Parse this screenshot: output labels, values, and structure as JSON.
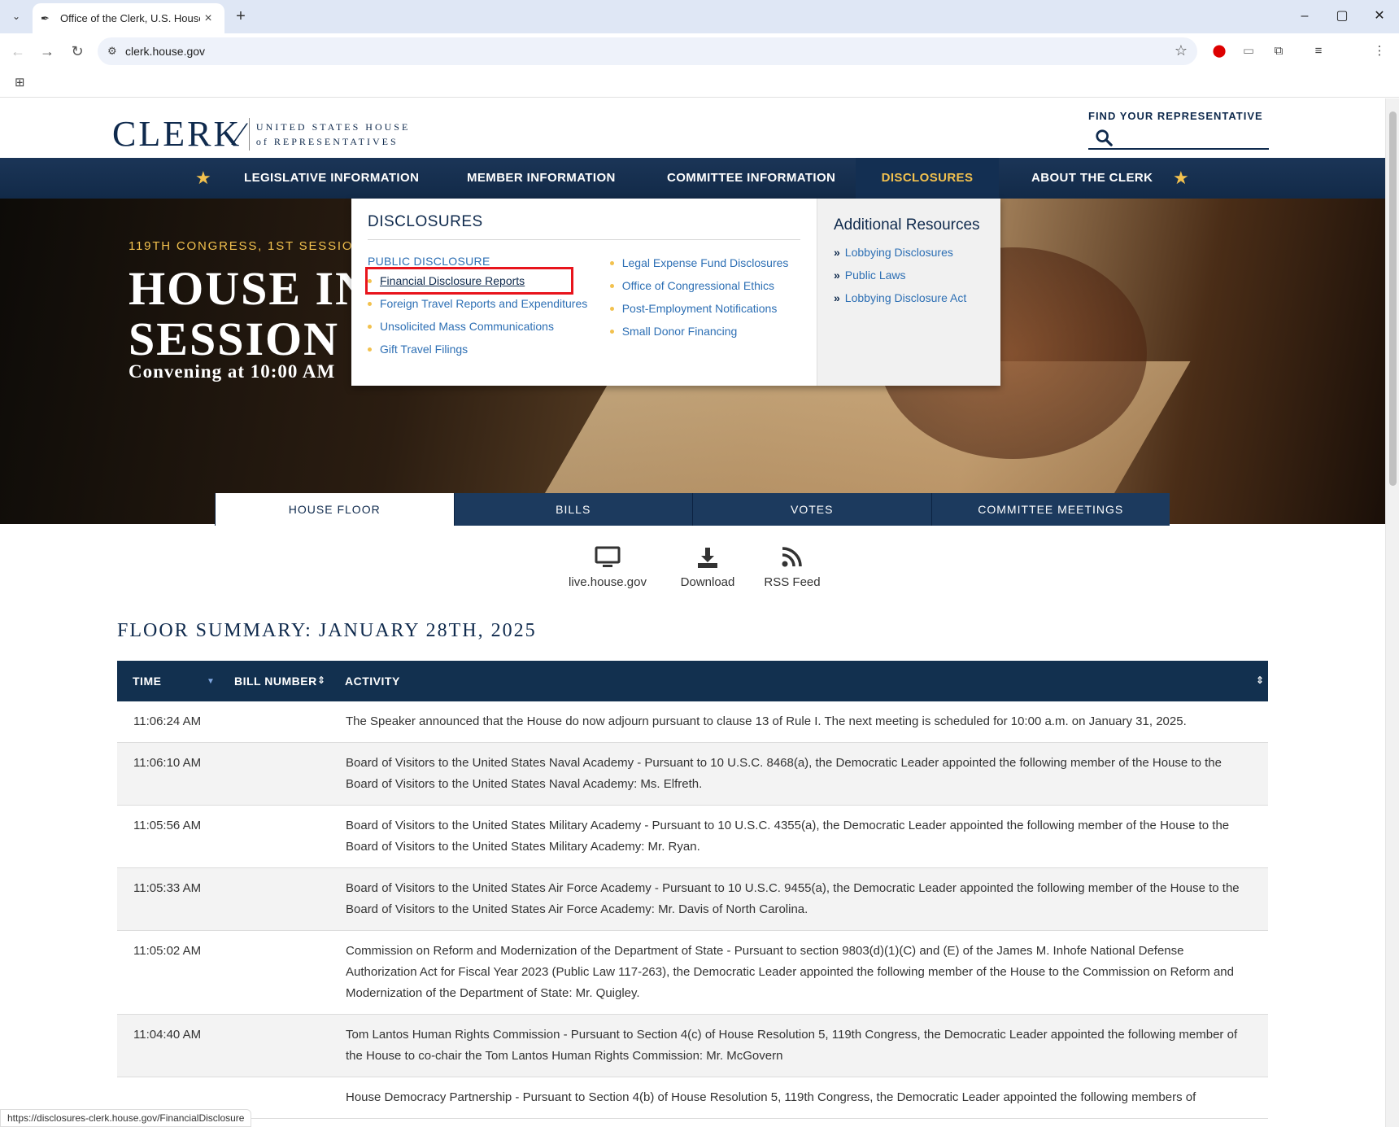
{
  "browser": {
    "tab_title": "Office of the Clerk, U.S. House",
    "url": "clerk.house.gov",
    "status_url": "https://disclosures-clerk.house.gov/FinancialDisclosure"
  },
  "header": {
    "logo_main": "CLERK",
    "logo_line1": "UNITED STATES HOUSE",
    "logo_line2": "of REPRESENTATIVES",
    "find_rep_label": "FIND YOUR REPRESENTATIVE"
  },
  "nav": {
    "items": [
      {
        "label": "LEGISLATIVE INFORMATION"
      },
      {
        "label": "MEMBER INFORMATION"
      },
      {
        "label": "COMMITTEE INFORMATION"
      },
      {
        "label": "DISCLOSURES"
      },
      {
        "label": "ABOUT THE CLERK"
      }
    ],
    "active": "DISCLOSURES"
  },
  "dropdown": {
    "heading": "DISCLOSURES",
    "subheading": "PUBLIC DISCLOSURE",
    "left_links": [
      "Financial Disclosure Reports",
      "Foreign Travel Reports and Expenditures",
      "Unsolicited Mass Communications",
      "Gift Travel Filings"
    ],
    "right_links": [
      "Legal Expense Fund Disclosures",
      "Office of Congressional Ethics",
      "Post-Employment Notifications",
      "Small Donor Financing"
    ],
    "side_heading": "Additional Resources",
    "side_links": [
      "Lobbying Disclosures",
      "Public Laws",
      "Lobbying Disclosure Act"
    ]
  },
  "hero": {
    "kicker": "119TH CONGRESS, 1ST SESSION",
    "title_line1": "HOUSE IN",
    "title_line2": "SESSION T",
    "subtitle": "Convening at 10:00 AM"
  },
  "tabs": [
    "HOUSE FLOOR",
    "BILLS",
    "VOTES",
    "COMMITTEE MEETINGS"
  ],
  "quick_links": [
    {
      "label": "live.house.gov",
      "icon": "monitor-icon"
    },
    {
      "label": "Download",
      "icon": "download-icon"
    },
    {
      "label": "RSS Feed",
      "icon": "rss-icon"
    }
  ],
  "floor": {
    "title": "FLOOR SUMMARY: JANUARY 28TH, 2025",
    "columns": [
      "TIME",
      "BILL NUMBER",
      "ACTIVITY"
    ],
    "rows": [
      {
        "time": "11:06:24 AM",
        "activity": "The Speaker announced that the House do now adjourn pursuant to clause 13 of Rule I. The next meeting is scheduled for 10:00 a.m. on January 31, 2025."
      },
      {
        "time": "11:06:10 AM",
        "activity": "Board of Visitors to the United States Naval Academy - Pursuant to 10 U.S.C. 8468(a), the Democratic Leader appointed the following member of the House to the Board of Visitors to the United States Naval Academy: Ms. Elfreth."
      },
      {
        "time": "11:05:56 AM",
        "activity": "Board of Visitors to the United States Military Academy - Pursuant to 10 U.S.C. 4355(a), the Democratic Leader appointed the following member of the House to the Board of Visitors to the United States Military Academy: Mr. Ryan."
      },
      {
        "time": "11:05:33 AM",
        "activity": "Board of Visitors to the United States Air Force Academy - Pursuant to 10 U.S.C. 9455(a), the Democratic Leader appointed the following member of the House to the Board of Visitors to the United States Air Force Academy: Mr. Davis of North Carolina."
      },
      {
        "time": "11:05:02 AM",
        "activity": "Commission on Reform and Modernization of the Department of State - Pursuant to section 9803(d)(1)(C) and (E) of the James M. Inhofe National Defense Authorization Act for Fiscal Year 2023 (Public Law 117-263), the Democratic Leader appointed the following member of the House to the Commission on Reform and Modernization of the Department of State: Mr. Quigley."
      },
      {
        "time": "11:04:40 AM",
        "activity": "Tom Lantos Human Rights Commission - Pursuant to Section 4(c) of House Resolution 5, 119th Congress, the Democratic Leader appointed the following member of the House to co-chair the Tom Lantos Human Rights Commission: Mr. McGovern"
      },
      {
        "time": "",
        "activity": "House Democracy Partnership - Pursuant to Section 4(b) of House Resolution 5, 119th Congress, the Democratic Leader appointed the following members of"
      }
    ]
  }
}
